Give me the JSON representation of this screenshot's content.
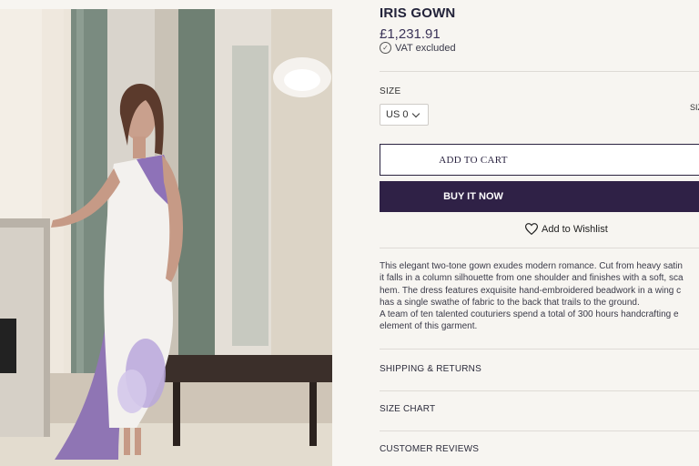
{
  "product": {
    "title": "IRIS GOWN",
    "price": "£1,231.91",
    "vat_note": "VAT excluded"
  },
  "size": {
    "label": "SIZE",
    "selected": "US 0",
    "guide_label": "SIZ"
  },
  "actions": {
    "add_to_cart": "ADD TO CART",
    "buy_now": "BUY IT NOW",
    "wishlist": "Add to Wishlist"
  },
  "description": {
    "lines": [
      "This elegant two-tone gown exudes modern romance. Cut from heavy satin",
      "it falls in a column silhouette from one shoulder and finishes with a soft, sca",
      "hem. The dress features exquisite hand-embroidered beadwork in a wing c",
      "has a single swathe of fabric to the back that trails to the ground.",
      "A team of ten talented couturiers spend a total of 300 hours handcrafting e",
      "element of this garment."
    ]
  },
  "accordions": {
    "shipping": "SHIPPING & RETURNS",
    "size_chart": "SIZE CHART",
    "reviews": "CUSTOMER REVIEWS"
  },
  "icons": {
    "vat": "check-circle-icon",
    "size_dropdown": "chevron-down-icon",
    "wishlist": "heart-icon"
  },
  "colors": {
    "brand_purple": "#2f2146",
    "gown_lilac": "#9b7fc0",
    "background": "#f7f5f1"
  }
}
